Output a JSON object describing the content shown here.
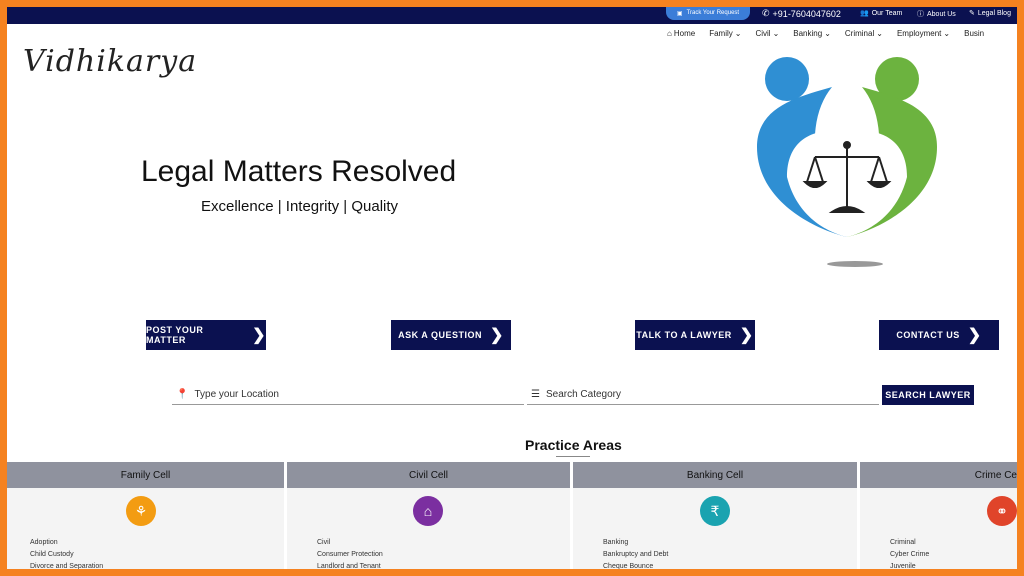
{
  "topbar": {
    "track_label": "Track Your Request",
    "phone": "+91-7604047602",
    "our_team": "Our Team",
    "about_us": "About Us",
    "legal_blog": "Legal Blog"
  },
  "nav": {
    "home": "Home",
    "family": "Family",
    "civil": "Civil",
    "banking": "Banking",
    "criminal": "Criminal",
    "employment": "Employment",
    "business": "Busin"
  },
  "brand": {
    "logo": "Vidhikarya"
  },
  "hero": {
    "title": "Legal Matters Resolved",
    "subtitle": "Excellence | Integrity | Quality"
  },
  "cta": {
    "post": "POST YOUR MATTER",
    "ask": "ASK A QUESTION",
    "talk": "TALK TO A LAWYER",
    "contact": "CONTACT US"
  },
  "search": {
    "location_placeholder": "Type your Location",
    "category_placeholder": "Search Category",
    "button": "SEARCH LAWYER"
  },
  "practice": {
    "title": "Practice Areas",
    "cells": [
      {
        "name": "Family Cell",
        "color": "#f39c12",
        "items": [
          "Adoption",
          "Child Custody",
          "Divorce and Separation"
        ]
      },
      {
        "name": "Civil Cell",
        "color": "#7b2fa0",
        "items": [
          "Civil",
          "Consumer Protection",
          "Landlord and Tenant"
        ]
      },
      {
        "name": "Banking Cell",
        "color": "#1aa3b0",
        "items": [
          "Banking",
          "Bankruptcy and Debt",
          "Cheque Bounce"
        ]
      },
      {
        "name": "Crime Ce",
        "color": "#e0442a",
        "items": [
          "Criminal",
          "Cyber Crime",
          "Juvenile"
        ]
      }
    ]
  },
  "colors": {
    "navy": "#0b1150",
    "frame": "#f58220",
    "accent_blue": "#3b7dd8"
  }
}
